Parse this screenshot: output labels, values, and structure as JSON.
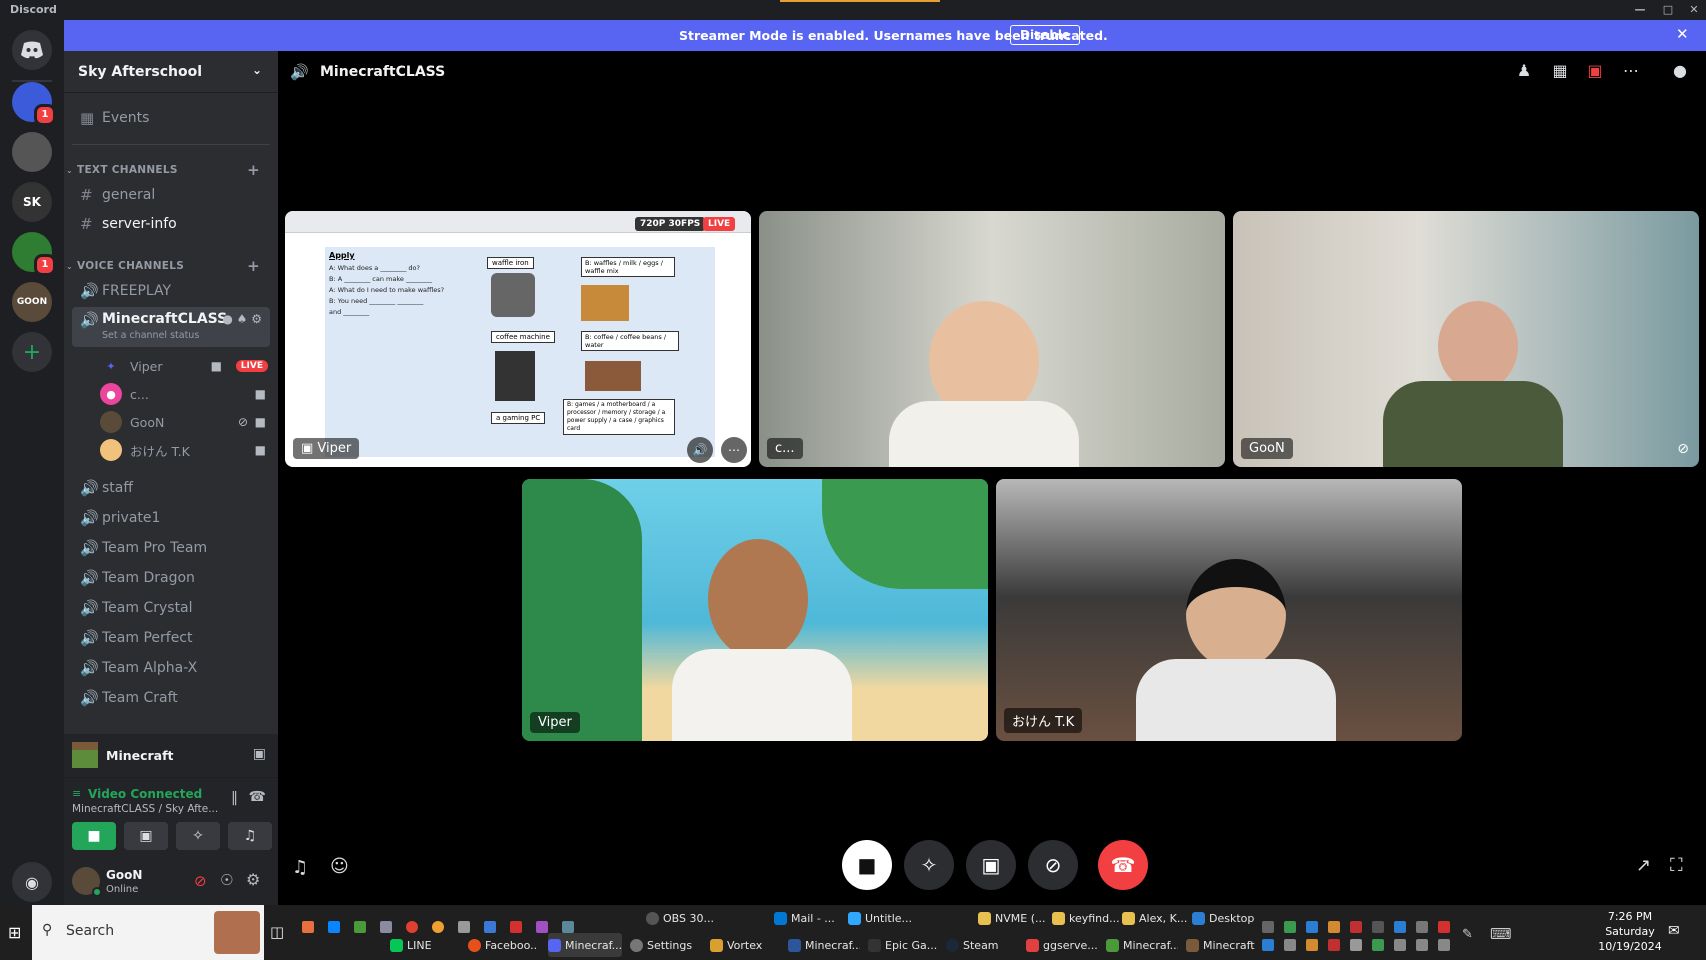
{
  "window": {
    "title": "Discord"
  },
  "banner": {
    "message": "Streamer Mode is enabled. Usernames have been truncated.",
    "disable_label": "Disable"
  },
  "guilds": [
    {
      "label": "",
      "color": "#3b5bdb",
      "badge": "1"
    },
    {
      "label": "",
      "color": "#555",
      "badge": ""
    },
    {
      "label": "SK",
      "color": "#333",
      "badge": ""
    },
    {
      "label": "",
      "color": "#2e7d32",
      "badge": "1"
    },
    {
      "label": "GOON",
      "color": "#5a4a3a",
      "badge": ""
    }
  ],
  "server": {
    "name": "Sky Afterschool"
  },
  "sidebar": {
    "events_label": "Events",
    "text_category": "TEXT CHANNELS",
    "text_channels": [
      "general",
      "server-info"
    ],
    "voice_category": "VOICE CHANNELS",
    "voice_channels_top": [
      "FREEPLAY"
    ],
    "active_channel": "MinecraftCLASS",
    "channel_status": "Set a channel status",
    "voice_users": [
      {
        "name": "Viper",
        "live": "LIVE"
      },
      {
        "name": "c..."
      },
      {
        "name": "GooN"
      },
      {
        "name": "おけん T.K"
      }
    ],
    "voice_channels_bottom": [
      "staff",
      "private1",
      "Team Pro Team",
      "Team Dragon",
      "Team Crystal",
      "Team Perfect",
      "Team Alpha-X",
      "Team Craft"
    ]
  },
  "activity": {
    "name": "Minecraft"
  },
  "voice_status": {
    "title": "Video Connected",
    "subtitle": "MinecraftCLASS / Sky Afte..."
  },
  "user": {
    "name": "GooN",
    "status": "Online"
  },
  "main": {
    "channel_title": "MinecraftCLASS"
  },
  "stream": {
    "quality": "720P 30FPS",
    "live": "LIVE",
    "doc_heading": "Apply",
    "lines": [
      "A: What does a ________ do?",
      "B: A ________ can make ________",
      "A: What do I need to make waffles?",
      "B: You need ________ ________",
      "and ________"
    ],
    "box1": "waffle iron",
    "box2": "B: waffles / milk / eggs / waffle mix",
    "box3": "coffee machine",
    "box4": "B: coffee / coffee beans / water",
    "box5": "a gaming PC",
    "box6": "B: games / a motherboard / a processor / memory / storage / a power supply / a case / graphics card"
  },
  "tiles": [
    {
      "name": "Viper"
    },
    {
      "name": "c..."
    },
    {
      "name": "GooN"
    },
    {
      "name": "Viper"
    },
    {
      "name": "おけん T.K"
    }
  ],
  "taskbar": {
    "search_placeholder": "Search",
    "time": "7:26 PM",
    "day": "Saturday",
    "date": "10/19/2024",
    "top_row": [
      "OBS 30...",
      "Mail - ...",
      "Untitle...",
      "NVME (...",
      "keyfind...",
      "Alex, K...",
      "Desktop"
    ],
    "bottom_row": [
      "LINE",
      "Faceboo...",
      "Minecraf...",
      "Settings",
      "Vortex",
      "Minecraf...",
      "Epic Ga...",
      "Steam",
      "ggserve...",
      "Minecraf...",
      "Minecraft"
    ]
  }
}
